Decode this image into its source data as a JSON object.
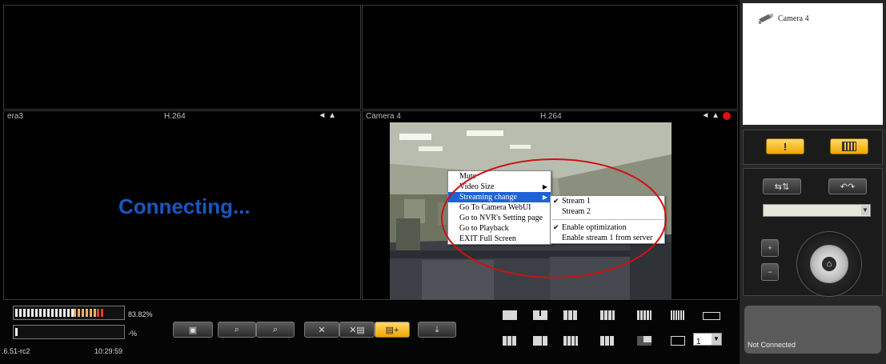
{
  "camera_tree": {
    "item_label": "Camera 4"
  },
  "panes": {
    "left": {
      "name": "era3",
      "codec": "H.264",
      "icons": "◄ ▲",
      "status": "Connecting..."
    },
    "right": {
      "name": "Camera 4",
      "codec": "H.264",
      "icons": "◄ ▲"
    }
  },
  "context_menu": {
    "items": [
      "Mute",
      "Video Size",
      "Streaming change",
      "Go To Camera WebUI",
      "Go to NVR's Setting page",
      "Go to Playback",
      "EXIT Full Screen"
    ],
    "submenu": [
      "Stream 1",
      "Stream 2",
      "Enable optimization",
      "Enable stream 1 from server"
    ],
    "check_mark": "✔"
  },
  "status_bar": {
    "cpu_percent": "83.82%",
    "cpu_fill": 0.8382,
    "second_percent": "-%",
    "version": ".6.51-rc2",
    "time": "10:29:59"
  },
  "layout_select": {
    "value": "1"
  },
  "right_panel": {
    "alarm_label": "!",
    "ptz_input": "",
    "status": "Not Connected"
  },
  "colors": {
    "connecting_text": "#1a56c2",
    "menu_highlight": "#1d62d6",
    "accent_yellow": "#f0a800",
    "ellipse": "#d01010"
  }
}
